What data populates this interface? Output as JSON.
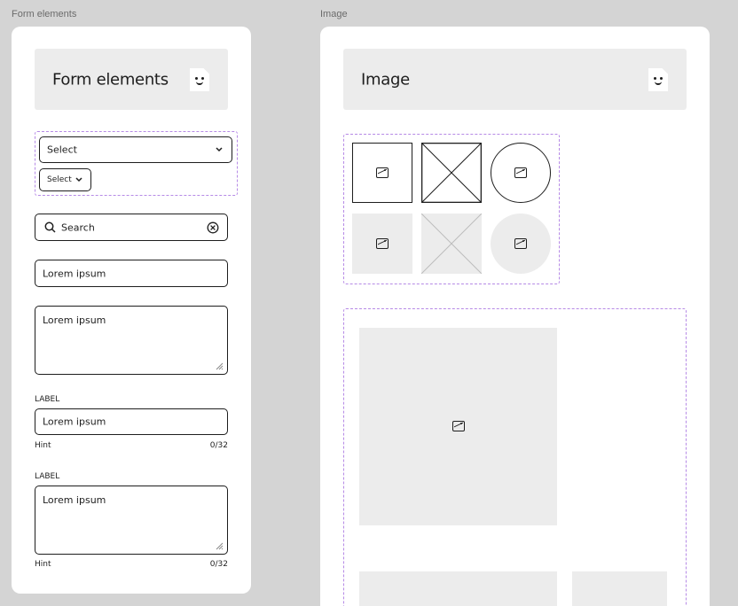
{
  "frames": {
    "form": {
      "label": "Form elements",
      "header_title": "Form elements",
      "select_large": "Select",
      "select_small": "Select",
      "search_placeholder": "Search",
      "input_value": "Lorem ipsum",
      "textarea_value": "Lorem ipsum",
      "labeled_input": {
        "label": "LABEL",
        "value": "Lorem ipsum",
        "hint": "Hint",
        "counter": "0/32"
      },
      "labeled_textarea": {
        "label": "LABEL",
        "value": "Lorem ipsum",
        "hint": "Hint",
        "counter": "0/32"
      }
    },
    "image": {
      "label": "Image",
      "header_title": "Image"
    }
  },
  "colors": {
    "canvas": "#d4d4d4",
    "card": "#ffffff",
    "header": "#ececec",
    "placeholder_fill": "#ececec",
    "dashed_outline": "#b68ae6",
    "stroke": "#1e1e1e"
  },
  "icons": [
    "doc-face-icon",
    "chevron-down-icon",
    "search-icon",
    "clear-icon",
    "image-icon",
    "resize-handle-icon"
  ]
}
